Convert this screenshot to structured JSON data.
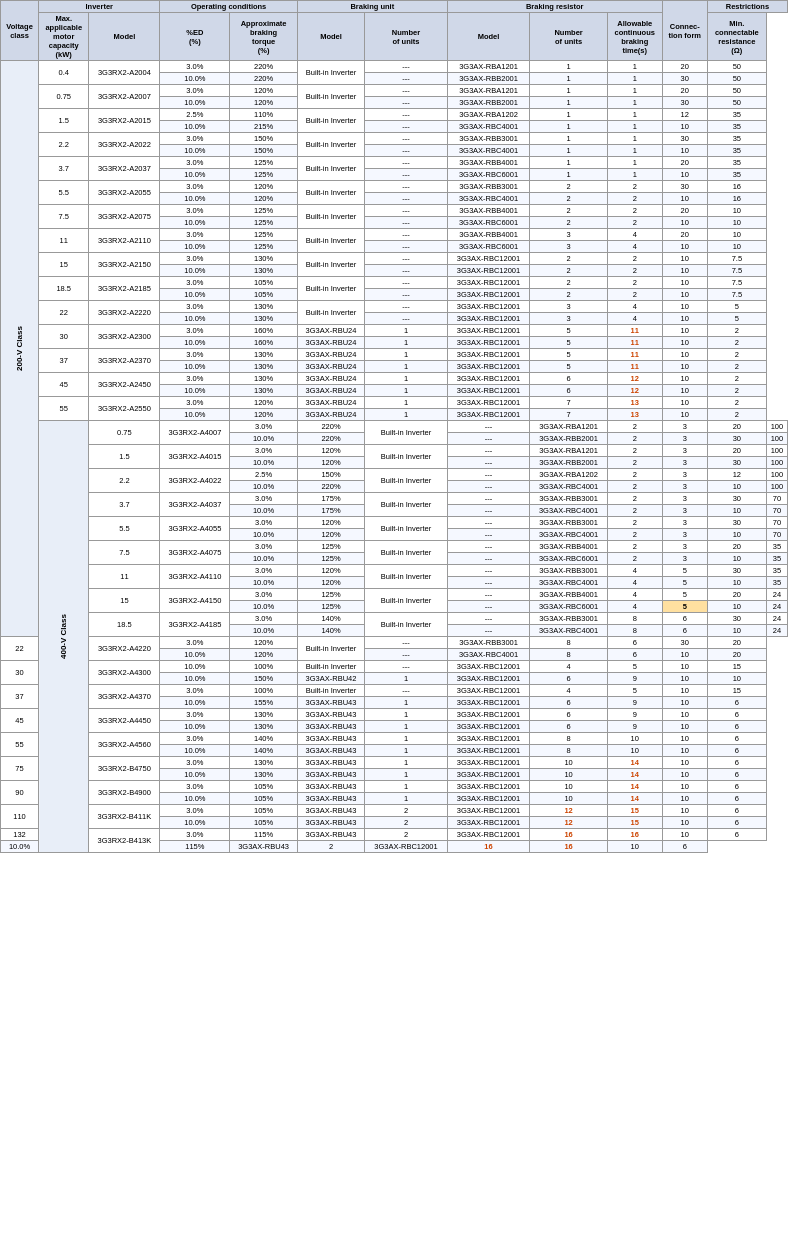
{
  "headers": {
    "col_groups": [
      {
        "label": "Inverter",
        "colspan": 3
      },
      {
        "label": "Operating conditions",
        "colspan": 2
      },
      {
        "label": "Braking unit",
        "colspan": 2
      },
      {
        "label": "Braking resistor",
        "colspan": 3
      },
      {
        "label": "Connec-tion form",
        "colspan": 1
      },
      {
        "label": "Restrictions",
        "colspan": 2
      }
    ],
    "sub_headers": [
      {
        "label": "Voltage class"
      },
      {
        "label": "Max. applicable motor capacity (kW)"
      },
      {
        "label": "Model"
      },
      {
        "label": "%ED (%)"
      },
      {
        "label": "Approximate braking torque (%)"
      },
      {
        "label": "Model"
      },
      {
        "label": "Number of units"
      },
      {
        "label": "Model"
      },
      {
        "label": "Number of units"
      },
      {
        "label": "Connec-tion form"
      },
      {
        "label": "Allowable continuous braking time(s)"
      },
      {
        "label": "Min. connectable resistance (Ω)"
      }
    ]
  },
  "rows": [
    {
      "vclass": "200-V Class",
      "vspan": 48,
      "motor": "0.4",
      "mspan": 2,
      "model": "3G3RX2-A2004",
      "modespan": 2,
      "ed": "3.0%",
      "torque": "220%",
      "bumodel": "Built-in Inverter",
      "buspan": 2,
      "bunits": "---",
      "brmodel": "3G3AX-RBA1201",
      "brnunits": "1",
      "connform": "1",
      "allowtime": "20",
      "minres": "50"
    },
    {
      "ed": "10.0%",
      "torque": "220%",
      "bunits": "---",
      "brmodel": "3G3AX-RBB2001",
      "brnunits": "1",
      "connform": "1",
      "allowtime": "30",
      "minres": "50"
    },
    {
      "motor": "0.75",
      "mspan": 2,
      "model": "3G3RX2-A2007",
      "modespan": 2,
      "ed": "3.0%",
      "torque": "120%",
      "bumodel": "Built-in Inverter",
      "buspan": 2,
      "bunits": "---",
      "brmodel": "3G3AX-RBA1201",
      "brnunits": "1",
      "connform": "1",
      "allowtime": "20",
      "minres": "50"
    },
    {
      "ed": "10.0%",
      "torque": "120%",
      "bunits": "---",
      "brmodel": "3G3AX-RBB2001",
      "brnunits": "1",
      "connform": "1",
      "allowtime": "30",
      "minres": "50"
    },
    {
      "motor": "1.5",
      "mspan": 2,
      "model": "3G3RX2-A2015",
      "modespan": 2,
      "ed": "2.5%",
      "torque": "110%",
      "bumodel": "Built-in Inverter",
      "buspan": 2,
      "bunits": "---",
      "brmodel": "3G3AX-RBA1202",
      "brnunits": "1",
      "connform": "1",
      "allowtime": "12",
      "minres": "35"
    },
    {
      "ed": "10.0%",
      "torque": "215%",
      "bunits": "---",
      "brmodel": "3G3AX-RBC4001",
      "brnunits": "1",
      "connform": "1",
      "allowtime": "10",
      "minres": "35"
    },
    {
      "motor": "2.2",
      "mspan": 2,
      "model": "3G3RX2-A2022",
      "modespan": 2,
      "ed": "3.0%",
      "torque": "150%",
      "bumodel": "Built-in Inverter",
      "buspan": 2,
      "bunits": "---",
      "brmodel": "3G3AX-RBB3001",
      "brnunits": "1",
      "connform": "1",
      "allowtime": "30",
      "minres": "35"
    },
    {
      "ed": "10.0%",
      "torque": "150%",
      "bunits": "---",
      "brmodel": "3G3AX-RBC4001",
      "brnunits": "1",
      "connform": "1",
      "allowtime": "10",
      "minres": "35"
    },
    {
      "motor": "3.7",
      "mspan": 2,
      "model": "3G3RX2-A2037",
      "modespan": 2,
      "ed": "3.0%",
      "torque": "125%",
      "bumodel": "Built-in Inverter",
      "buspan": 2,
      "bunits": "---",
      "brmodel": "3G3AX-RBB4001",
      "brnunits": "1",
      "connform": "1",
      "allowtime": "20",
      "minres": "35"
    },
    {
      "ed": "10.0%",
      "torque": "125%",
      "bunits": "---",
      "brmodel": "3G3AX-RBC6001",
      "brnunits": "1",
      "connform": "1",
      "allowtime": "10",
      "minres": "35"
    },
    {
      "motor": "5.5",
      "mspan": 2,
      "model": "3G3RX2-A2055",
      "modespan": 2,
      "ed": "3.0%",
      "torque": "120%",
      "bumodel": "Built-in Inverter",
      "buspan": 2,
      "bunits": "---",
      "brmodel": "3G3AX-RBB3001",
      "brnunits": "2",
      "connform": "2",
      "allowtime": "30",
      "minres": "16"
    },
    {
      "ed": "10.0%",
      "torque": "120%",
      "bunits": "---",
      "brmodel": "3G3AX-RBC4001",
      "brnunits": "2",
      "connform": "2",
      "allowtime": "10",
      "minres": "16"
    },
    {
      "motor": "7.5",
      "mspan": 2,
      "model": "3G3RX2-A2075",
      "modespan": 2,
      "ed": "3.0%",
      "torque": "125%",
      "bumodel": "Built-in Inverter",
      "buspan": 2,
      "bunits": "---",
      "brmodel": "3G3AX-RBB4001",
      "brnunits": "2",
      "connform": "2",
      "allowtime": "20",
      "minres": "10"
    },
    {
      "ed": "10.0%",
      "torque": "125%",
      "bunits": "---",
      "brmodel": "3G3AX-RBC6001",
      "brnunits": "2",
      "connform": "2",
      "allowtime": "10",
      "minres": "10"
    },
    {
      "motor": "11",
      "mspan": 2,
      "model": "3G3RX2-A2110",
      "modespan": 2,
      "ed": "3.0%",
      "torque": "125%",
      "bumodel": "Built-in Inverter",
      "buspan": 2,
      "bunits": "---",
      "brmodel": "3G3AX-RBB4001",
      "brnunits": "3",
      "connform": "4",
      "allowtime": "20",
      "minres": "10"
    },
    {
      "ed": "10.0%",
      "torque": "125%",
      "bunits": "---",
      "brmodel": "3G3AX-RBC6001",
      "brnunits": "3",
      "connform": "4",
      "allowtime": "10",
      "minres": "10"
    },
    {
      "motor": "15",
      "mspan": 2,
      "model": "3G3RX2-A2150",
      "modespan": 2,
      "ed": "3.0%",
      "torque": "130%",
      "bumodel": "Built-in Inverter",
      "buspan": 2,
      "bunits": "---",
      "brmodel": "3G3AX-RBC12001",
      "brnunits": "2",
      "connform": "2",
      "allowtime": "10",
      "minres": "7.5"
    },
    {
      "ed": "10.0%",
      "torque": "130%",
      "bunits": "---",
      "brmodel": "3G3AX-RBC12001",
      "brnunits": "2",
      "connform": "2",
      "allowtime": "10",
      "minres": "7.5"
    },
    {
      "motor": "18.5",
      "mspan": 2,
      "model": "3G3RX2-A2185",
      "modespan": 2,
      "ed": "3.0%",
      "torque": "105%",
      "bumodel": "Built-in Inverter",
      "buspan": 2,
      "bunits": "---",
      "brmodel": "3G3AX-RBC12001",
      "brnunits": "2",
      "connform": "2",
      "allowtime": "10",
      "minres": "7.5"
    },
    {
      "ed": "10.0%",
      "torque": "105%",
      "bunits": "---",
      "brmodel": "3G3AX-RBC12001",
      "brnunits": "2",
      "connform": "2",
      "allowtime": "10",
      "minres": "7.5"
    },
    {
      "motor": "22",
      "mspan": 2,
      "model": "3G3RX2-A2220",
      "modespan": 2,
      "ed": "3.0%",
      "torque": "130%",
      "bumodel": "Built-in Inverter",
      "buspan": 2,
      "bunits": "---",
      "brmodel": "3G3AX-RBC12001",
      "brnunits": "3",
      "connform": "4",
      "allowtime": "10",
      "minres": "5"
    },
    {
      "ed": "10.0%",
      "torque": "130%",
      "bunits": "---",
      "brmodel": "3G3AX-RBC12001",
      "brnunits": "3",
      "connform": "4",
      "allowtime": "10",
      "minres": "5"
    },
    {
      "motor": "30",
      "mspan": 2,
      "model": "3G3RX2-A2300",
      "modespan": 2,
      "ed": "3.0%",
      "torque": "160%",
      "bumodel": "3G3AX-RBU24",
      "bunits": "1",
      "brmodel": "3G3AX-RBC12001",
      "brnunits": "5",
      "connform": "11",
      "allowtime": "10",
      "minres": "2"
    },
    {
      "ed": "10.0%",
      "torque": "160%",
      "bumodel": "3G3AX-RBU24",
      "bunits": "1",
      "brmodel": "3G3AX-RBC12001",
      "brnunits": "5",
      "connform": "11",
      "allowtime": "10",
      "minres": "2"
    },
    {
      "motor": "37",
      "mspan": 2,
      "model": "3G3RX2-A2370",
      "modespan": 2,
      "ed": "3.0%",
      "torque": "130%",
      "bumodel": "3G3AX-RBU24",
      "bunits": "1",
      "brmodel": "3G3AX-RBC12001",
      "brnunits": "5",
      "connform": "11",
      "allowtime": "10",
      "minres": "2"
    },
    {
      "ed": "10.0%",
      "torque": "130%",
      "bumodel": "3G3AX-RBU24",
      "bunits": "1",
      "brmodel": "3G3AX-RBC12001",
      "brnunits": "5",
      "connform": "11",
      "allowtime": "10",
      "minres": "2"
    },
    {
      "motor": "45",
      "mspan": 2,
      "model": "3G3RX2-A2450",
      "modespan": 2,
      "ed": "3.0%",
      "torque": "130%",
      "bumodel": "3G3AX-RBU24",
      "bunits": "1",
      "brmodel": "3G3AX-RBC12001",
      "brnunits": "6",
      "connform": "12",
      "allowtime": "10",
      "minres": "2"
    },
    {
      "ed": "10.0%",
      "torque": "130%",
      "bumodel": "3G3AX-RBU24",
      "bunits": "1",
      "brmodel": "3G3AX-RBC12001",
      "brnunits": "6",
      "connform": "12",
      "allowtime": "10",
      "minres": "2"
    },
    {
      "motor": "55",
      "mspan": 2,
      "model": "3G3RX2-A2550",
      "modespan": 2,
      "ed": "3.0%",
      "torque": "120%",
      "bumodel": "3G3AX-RBU24",
      "bunits": "1",
      "brmodel": "3G3AX-RBC12001",
      "brnunits": "7",
      "connform": "13",
      "allowtime": "10",
      "minres": "2"
    },
    {
      "ed": "10.0%",
      "torque": "120%",
      "bumodel": "3G3AX-RBU24",
      "bunits": "1",
      "brmodel": "3G3AX-RBC12001",
      "brnunits": "7",
      "connform": "13",
      "allowtime": "10",
      "minres": "2"
    },
    {
      "vclass": "400-V Class",
      "vspan": 56,
      "motor": "0.75",
      "mspan": 2,
      "model": "3G3RX2-A4007",
      "modespan": 2,
      "ed": "3.0%",
      "torque": "220%",
      "bumodel": "Built-in Inverter",
      "buspan": 2,
      "bunits": "---",
      "brmodel": "3G3AX-RBA1201",
      "brnunits": "2",
      "connform": "3",
      "allowtime": "20",
      "minres": "100"
    },
    {
      "ed": "10.0%",
      "torque": "220%",
      "bunits": "---",
      "brmodel": "3G3AX-RBB2001",
      "brnunits": "2",
      "connform": "3",
      "allowtime": "30",
      "minres": "100"
    },
    {
      "motor": "1.5",
      "mspan": 2,
      "model": "3G3RX2-A4015",
      "modespan": 2,
      "ed": "3.0%",
      "torque": "120%",
      "bumodel": "Built-in Inverter",
      "buspan": 2,
      "bunits": "---",
      "brmodel": "3G3AX-RBA1201",
      "brnunits": "2",
      "connform": "3",
      "allowtime": "20",
      "minres": "100"
    },
    {
      "ed": "10.0%",
      "torque": "120%",
      "bunits": "---",
      "brmodel": "3G3AX-RBB2001",
      "brnunits": "2",
      "connform": "3",
      "allowtime": "30",
      "minres": "100"
    },
    {
      "motor": "2.2",
      "mspan": 2,
      "model": "3G3RX2-A4022",
      "modespan": 2,
      "ed": "2.5%",
      "torque": "150%",
      "bumodel": "Built-in Inverter",
      "buspan": 2,
      "bunits": "---",
      "brmodel": "3G3AX-RBA1202",
      "brnunits": "2",
      "connform": "3",
      "allowtime": "12",
      "minres": "100"
    },
    {
      "ed": "10.0%",
      "torque": "220%",
      "bunits": "---",
      "brmodel": "3G3AX-RBC4001",
      "brnunits": "2",
      "connform": "3",
      "allowtime": "10",
      "minres": "100"
    },
    {
      "motor": "3.7",
      "mspan": 2,
      "model": "3G3RX2-A4037",
      "modespan": 2,
      "ed": "3.0%",
      "torque": "175%",
      "bumodel": "Built-in Inverter",
      "buspan": 2,
      "bunits": "---",
      "brmodel": "3G3AX-RBB3001",
      "brnunits": "2",
      "connform": "3",
      "allowtime": "30",
      "minres": "70"
    },
    {
      "ed": "10.0%",
      "torque": "175%",
      "bunits": "---",
      "brmodel": "3G3AX-RBC4001",
      "brnunits": "2",
      "connform": "3",
      "allowtime": "10",
      "minres": "70"
    },
    {
      "motor": "5.5",
      "mspan": 2,
      "model": "3G3RX2-A4055",
      "modespan": 2,
      "ed": "3.0%",
      "torque": "120%",
      "bumodel": "Built-in Inverter",
      "buspan": 2,
      "bunits": "---",
      "brmodel": "3G3AX-RBB3001",
      "brnunits": "2",
      "connform": "3",
      "allowtime": "30",
      "minres": "70"
    },
    {
      "ed": "10.0%",
      "torque": "120%",
      "bunits": "---",
      "brmodel": "3G3AX-RBC4001",
      "brnunits": "2",
      "connform": "3",
      "allowtime": "10",
      "minres": "70"
    },
    {
      "motor": "7.5",
      "mspan": 2,
      "model": "3G3RX2-A4075",
      "modespan": 2,
      "ed": "3.0%",
      "torque": "125%",
      "bumodel": "Built-in Inverter",
      "buspan": 2,
      "bunits": "---",
      "brmodel": "3G3AX-RBB4001",
      "brnunits": "2",
      "connform": "3",
      "allowtime": "20",
      "minres": "35"
    },
    {
      "ed": "10.0%",
      "torque": "125%",
      "bunits": "---",
      "brmodel": "3G3AX-RBC6001",
      "brnunits": "2",
      "connform": "3",
      "allowtime": "10",
      "minres": "35"
    },
    {
      "motor": "11",
      "mspan": 2,
      "model": "3G3RX2-A4110",
      "modespan": 2,
      "ed": "3.0%",
      "torque": "120%",
      "bumodel": "Built-in Inverter",
      "buspan": 2,
      "bunits": "---",
      "brmodel": "3G3AX-RBB3001",
      "brnunits": "4",
      "connform": "5",
      "allowtime": "30",
      "minres": "35"
    },
    {
      "ed": "10.0%",
      "torque": "120%",
      "bunits": "---",
      "brmodel": "3G3AX-RBC4001",
      "brnunits": "4",
      "connform": "5",
      "allowtime": "10",
      "minres": "35"
    },
    {
      "motor": "15",
      "mspan": 2,
      "model": "3G3RX2-A4150",
      "modespan": 2,
      "ed": "3.0%",
      "torque": "125%",
      "bumodel": "Built-in Inverter",
      "buspan": 2,
      "bunits": "---",
      "brmodel": "3G3AX-RBB4001",
      "brnunits": "4",
      "connform": "5",
      "allowtime": "20",
      "minres": "24"
    },
    {
      "ed": "10.0%",
      "torque": "125%",
      "bunits": "---",
      "brmodel": "3G3AX-RBC6001",
      "brnunits": "4",
      "connform": "5",
      "allowtime": "10",
      "minres": "24",
      "highlight": true
    },
    {
      "motor": "18.5",
      "mspan": 2,
      "model": "3G3RX2-A4185",
      "modespan": 2,
      "ed": "3.0%",
      "torque": "140%",
      "bumodel": "Built-in Inverter",
      "buspan": 2,
      "bunits": "---",
      "brmodel": "3G3AX-RBB3001",
      "brnunits": "8",
      "connform": "6",
      "allowtime": "30",
      "minres": "24"
    },
    {
      "ed": "10.0%",
      "torque": "140%",
      "bunits": "---",
      "brmodel": "3G3AX-RBC4001",
      "brnunits": "8",
      "connform": "6",
      "allowtime": "10",
      "minres": "24"
    },
    {
      "motor": "22",
      "mspan": 2,
      "model": "3G3RX2-A4220",
      "modespan": 2,
      "ed": "3.0%",
      "torque": "120%",
      "bumodel": "Built-in Inverter",
      "buspan": 2,
      "bunits": "---",
      "brmodel": "3G3AX-RBB3001",
      "brnunits": "8",
      "connform": "6",
      "allowtime": "30",
      "minres": "20"
    },
    {
      "ed": "10.0%",
      "torque": "120%",
      "bunits": "---",
      "brmodel": "3G3AX-RBC4001",
      "brnunits": "8",
      "connform": "6",
      "allowtime": "10",
      "minres": "20"
    },
    {
      "motor": "30",
      "mspan": 2,
      "model": "3G3RX2-A4300",
      "modespan": 2,
      "ed": "10.0%",
      "torque": "100%",
      "bumodel": "Built-in Inverter",
      "bunits": "---",
      "brmodel": "3G3AX-RBC12001",
      "brnunits": "4",
      "connform": "5",
      "allowtime": "10",
      "minres": "15"
    },
    {
      "ed": "10.0%",
      "torque": "150%",
      "bumodel": "3G3AX-RBU42",
      "bunits": "1",
      "brmodel": "3G3AX-RBC12001",
      "brnunits": "6",
      "connform": "9",
      "allowtime": "10",
      "minres": "10"
    },
    {
      "motor": "37",
      "mspan": 2,
      "model": "3G3RX2-A4370",
      "modespan": 2,
      "ed": "3.0%",
      "torque": "100%",
      "bumodel": "Built-in Inverter",
      "bunits": "---",
      "brmodel": "3G3AX-RBC12001",
      "brnunits": "4",
      "connform": "5",
      "allowtime": "10",
      "minres": "15"
    },
    {
      "ed": "10.0%",
      "torque": "155%",
      "bumodel": "3G3AX-RBU43",
      "bunits": "1",
      "brmodel": "3G3AX-RBC12001",
      "brnunits": "6",
      "connform": "9",
      "allowtime": "10",
      "minres": "6"
    },
    {
      "motor": "45",
      "mspan": 2,
      "model": "3G3RX2-A4450",
      "modespan": 2,
      "ed": "3.0%",
      "torque": "130%",
      "bumodel": "3G3AX-RBU43",
      "bunits": "1",
      "brmodel": "3G3AX-RBC12001",
      "brnunits": "6",
      "connform": "9",
      "allowtime": "10",
      "minres": "6"
    },
    {
      "ed": "10.0%",
      "torque": "130%",
      "bumodel": "3G3AX-RBU43",
      "bunits": "1",
      "brmodel": "3G3AX-RBC12001",
      "brnunits": "6",
      "connform": "9",
      "allowtime": "10",
      "minres": "6"
    },
    {
      "motor": "55",
      "mspan": 2,
      "model": "3G3RX2-A4560",
      "modespan": 2,
      "ed": "3.0%",
      "torque": "140%",
      "bumodel": "3G3AX-RBU43",
      "bunits": "1",
      "brmodel": "3G3AX-RBC12001",
      "brnunits": "8",
      "connform": "10",
      "allowtime": "10",
      "minres": "6"
    },
    {
      "ed": "10.0%",
      "torque": "140%",
      "bumodel": "3G3AX-RBU43",
      "bunits": "1",
      "brmodel": "3G3AX-RBC12001",
      "brnunits": "8",
      "connform": "10",
      "allowtime": "10",
      "minres": "6"
    },
    {
      "motor": "75",
      "mspan": 2,
      "model": "3G3RX2-B4750",
      "modespan": 2,
      "ed": "3.0%",
      "torque": "130%",
      "bumodel": "3G3AX-RBU43",
      "bunits": "1",
      "brmodel": "3G3AX-RBC12001",
      "brnunits": "10",
      "connform": "14",
      "allowtime": "10",
      "minres": "6"
    },
    {
      "ed": "10.0%",
      "torque": "130%",
      "bumodel": "3G3AX-RBU43",
      "bunits": "1",
      "brmodel": "3G3AX-RBC12001",
      "brnunits": "10",
      "connform": "14",
      "allowtime": "10",
      "minres": "6"
    },
    {
      "motor": "90",
      "mspan": 2,
      "model": "3G3RX2-B4900",
      "modespan": 2,
      "ed": "3.0%",
      "torque": "105%",
      "bumodel": "3G3AX-RBU43",
      "bunits": "1",
      "brmodel": "3G3AX-RBC12001",
      "brnunits": "10",
      "connform": "14",
      "allowtime": "10",
      "minres": "6"
    },
    {
      "ed": "10.0%",
      "torque": "105%",
      "bumodel": "3G3AX-RBU43",
      "bunits": "1",
      "brmodel": "3G3AX-RBC12001",
      "brnunits": "10",
      "connform": "14",
      "allowtime": "10",
      "minres": "6"
    },
    {
      "motor": "110",
      "mspan": 2,
      "model": "3G3RX2-B411K",
      "modespan": 2,
      "ed": "3.0%",
      "torque": "105%",
      "bumodel": "3G3AX-RBU43",
      "bunits": "2",
      "brmodel": "3G3AX-RBC12001",
      "brnunits": "12",
      "connform": "15",
      "allowtime": "10",
      "minres": "6"
    },
    {
      "ed": "10.0%",
      "torque": "105%",
      "bumodel": "3G3AX-RBU43",
      "bunits": "2",
      "brmodel": "3G3AX-RBC12001",
      "brnunits": "12",
      "connform": "15",
      "allowtime": "10",
      "minres": "6"
    },
    {
      "motor": "132",
      "mspan": 1,
      "model": "3G3RX2-B413K",
      "modespan": 2,
      "ed": "3.0%",
      "torque": "115%",
      "bumodel": "3G3AX-RBU43",
      "bunits": "2",
      "brmodel": "3G3AX-RBC12001",
      "brnunits": "16",
      "connform": "16",
      "allowtime": "10",
      "minres": "6"
    },
    {
      "ed": "10.0%",
      "torque": "115%",
      "bumodel": "3G3AX-RBU43",
      "bunits": "2",
      "brmodel": "3G3AX-RBC12001",
      "brnunits": "16",
      "connform": "16",
      "allowtime": "10",
      "minres": "6"
    }
  ]
}
